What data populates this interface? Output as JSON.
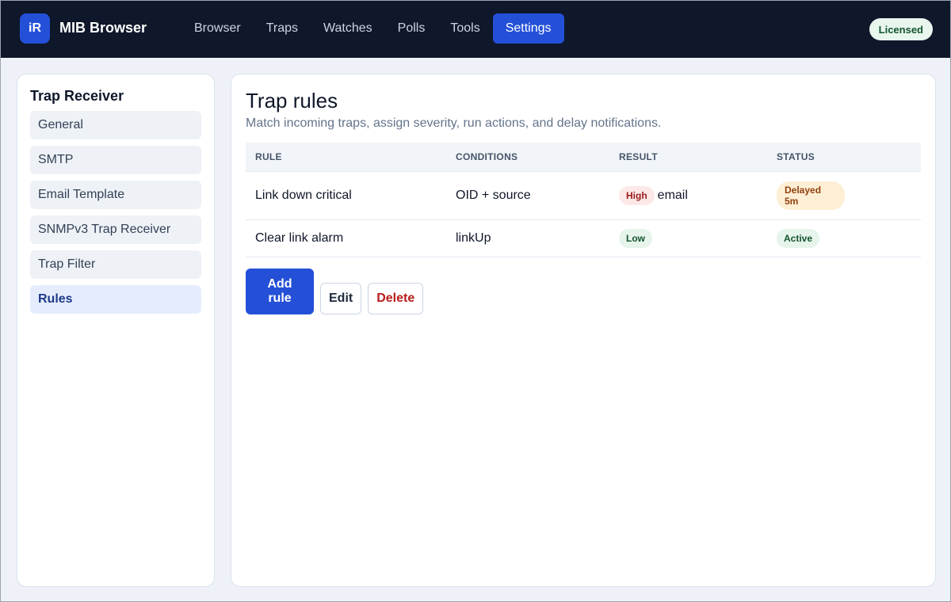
{
  "app": {
    "logo_text": "iR",
    "title": "MIB Browser",
    "license_badge": "Licensed"
  },
  "nav": {
    "items": [
      {
        "label": "Browser"
      },
      {
        "label": "Traps"
      },
      {
        "label": "Watches"
      },
      {
        "label": "Polls"
      },
      {
        "label": "Tools"
      },
      {
        "label": "Settings",
        "active": true
      }
    ]
  },
  "sidebar": {
    "title": "Trap Receiver",
    "items": [
      {
        "label": "General"
      },
      {
        "label": "SMTP"
      },
      {
        "label": "Email Template"
      },
      {
        "label": "SNMPv3 Trap Receiver"
      },
      {
        "label": "Trap Filter"
      },
      {
        "label": "Rules",
        "active": true
      }
    ]
  },
  "main": {
    "title": "Trap rules",
    "subtitle": "Match incoming traps, assign severity, run actions, and delay notifications.",
    "table": {
      "headers": [
        "RULE",
        "CONDITIONS",
        "RESULT",
        "STATUS"
      ],
      "rows": [
        {
          "rule": "Link down critical",
          "conditions": "OID + source",
          "severity": "High",
          "action": "email",
          "status": "Delayed 5m"
        },
        {
          "rule": "Clear link alarm",
          "conditions": "linkUp",
          "severity": "Low",
          "action": "",
          "status": "Active"
        }
      ]
    },
    "buttons": {
      "add": "Add rule",
      "edit": "Edit",
      "delete": "Delete"
    }
  },
  "colors": {
    "topbar": "#0f172a",
    "accent": "#2450d8",
    "high": "#991b1b",
    "low": "#14532d",
    "delayed": "#92400e"
  }
}
